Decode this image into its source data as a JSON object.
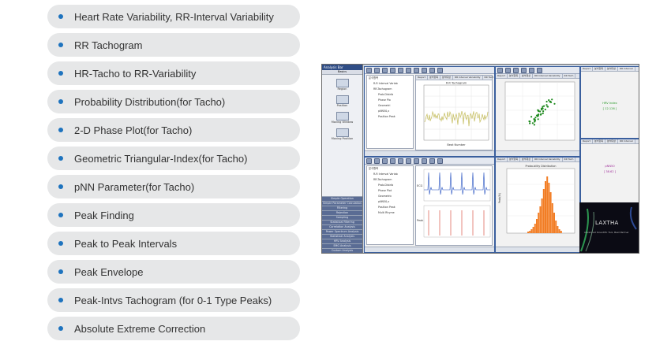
{
  "features": [
    "Heart Rate Variability, RR-Interval Variability",
    "RR Tachogram",
    "HR-Tacho to RR-Variability",
    "Probability Distribution(for Tacho)",
    "2-D Phase Plot(for Tacho)",
    "Geometric Triangular-Index(for Tacho)",
    "pNN Parameter(for Tacho)",
    "Peak Finding",
    "Peak to Peak Intervals",
    "Peak Envelope",
    "Peak-Intvs Tachogram (for 0-1 Type Peaks)",
    "Absolute Extreme Correction"
  ],
  "screenshot": {
    "sidebar_title": "Analysis Bar",
    "sidebar_sub": "Basics",
    "sidebar_items": [
      "Region",
      "Position",
      "Moving Window",
      "Moving Position"
    ],
    "sidebar_buttons": [
      "Simple Operation",
      "Simple Parameter Calculation",
      "Filtering",
      "Rejection",
      "Sampling",
      "Statistical Filtering",
      "Correlation Analysis",
      "Power Spectrum Analysis",
      "Statistical Analysis",
      "HRV Analysis",
      "EMG Analysis",
      "Custom Analysis"
    ],
    "tree_top": [
      "분석항목",
      "R-R Interval Variab",
      "RR-Tachogram",
      "Prob.Distrib",
      "Phase Plo",
      "Geometri",
      "pNN50,x",
      "Position Peak"
    ],
    "tree_bottom": [
      "분석항목",
      "R-R Interval Variab",
      "RR-Tachogram",
      "Prob.Distrib",
      "Phase Plot",
      "Geometric",
      "pNN50,x",
      "Position Peak",
      "Multi Rhyme"
    ],
    "tabs_a": [
      "Report",
      "분석항목",
      "분석대상",
      "RR Interval Variability",
      "RR Tach"
    ],
    "tabs_b": [
      "Report",
      "분석항목",
      "분석대상",
      "RR Interval Variability",
      "RR Tach"
    ],
    "tabs_c": [
      "Report",
      "분석항목",
      "분석대상",
      "RR Interval"
    ],
    "plot_top_title": "R-R Tachogram",
    "plot_top_xlabel": "Beat Number",
    "plot_bottom_title": "Proba-bility Distribution",
    "plot_bottom_ylabel": "Prob(%)",
    "ecg_label": "ECG",
    "peak_label": "Peak",
    "report_top_line1": "HRV Index",
    "report_top_line2": "[ 12.126 ]",
    "report_bottom_line1": "pNN50",
    "report_bottom_line2": "[ 38.62 ]",
    "logo_text": "LAXTHA",
    "logo_sub": "Advanced Scientific Tool, Best Partner"
  },
  "colors": {
    "pill_bg": "#e6e7e8",
    "bullet": "#1e73be",
    "text": "#333333",
    "tacho_line": "#c9c26a",
    "scatter": "#1e8a1e",
    "ecg": "#2450c0",
    "peak": "#d23a2a",
    "hist": "#f27d24"
  }
}
